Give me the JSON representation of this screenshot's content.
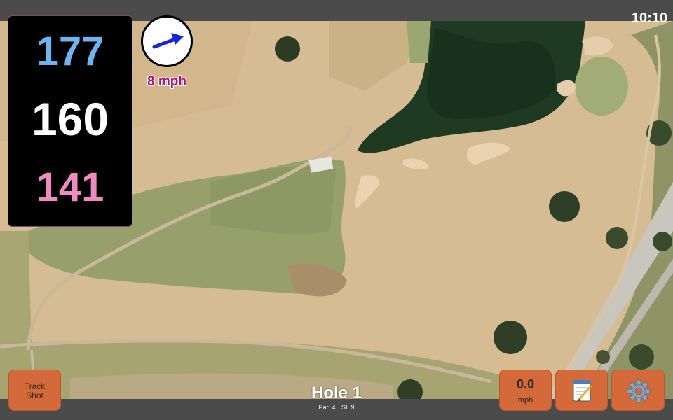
{
  "status_bar": {
    "time": "10:10"
  },
  "distances": {
    "back": "177",
    "middle": "160",
    "front": "141"
  },
  "wind": {
    "speed_label": "8 mph",
    "direction_icon": "arrow-right-up"
  },
  "controls": {
    "track_shot_label": "Track Shot",
    "speed_value": "0.0",
    "speed_unit": "mph",
    "notes_icon": "notepad-icon",
    "settings_icon": "gear-icon"
  },
  "hole": {
    "title": "Hole 1",
    "par": "Par: 4",
    "stroke_index": "SI: 9"
  },
  "colors": {
    "back_distance": "#6fb4ee",
    "middle_distance": "#ffffff",
    "front_distance": "#ee8cc2",
    "button": "#d4693a",
    "wind_text": "#a2157c"
  }
}
